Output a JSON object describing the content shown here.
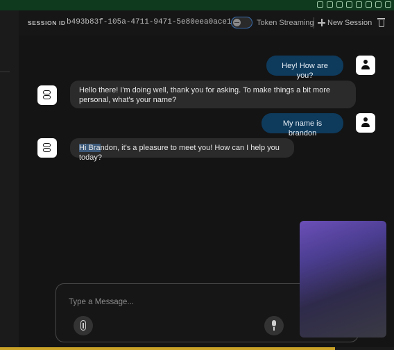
{
  "header": {
    "session_label": "SESSION ID",
    "session_id": "b493b83f-105a-4711-9471-5e80eea0ace1",
    "token_streaming_label": "Token Streaming",
    "token_streaming_enabled": false,
    "new_session_label": "New Session"
  },
  "messages": [
    {
      "role": "user",
      "text": "Hey! How are you?"
    },
    {
      "role": "assistant",
      "text": "Hello there! I'm doing well, thank you for asking. To make things a bit more personal, what's your name?"
    },
    {
      "role": "user",
      "text": "My name is brandon"
    },
    {
      "role": "assistant",
      "text_highlighted": "Hi Bra",
      "text_rest": "ndon, it's a pleasure to meet you! How can I help you today?"
    }
  ],
  "composer": {
    "placeholder": "Type a Message...",
    "value": ""
  },
  "icons": {
    "user_avatar": "person-icon",
    "assistant_avatar": "bot-icon",
    "attach": "paperclip-icon",
    "mic": "microphone-icon",
    "new_session": "plus-icon",
    "delete": "trash-icon"
  },
  "progress": {
    "fraction": 0.85
  },
  "colors": {
    "user_bubble": "#0e3a5c",
    "assistant_bubble": "#2b2b2b",
    "toggle_border": "#3a6fb0",
    "progress_fill": "#c9a227"
  }
}
